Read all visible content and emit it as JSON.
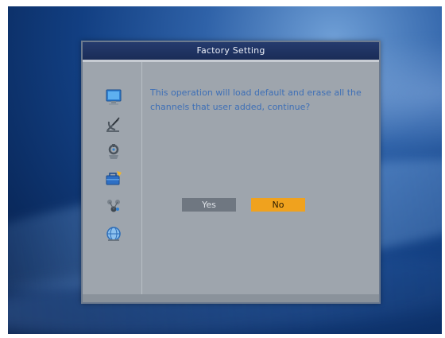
{
  "dialog": {
    "title": "Factory Setting",
    "message": "This operation will load default and erase all the channels that user added, continue?",
    "buttons": {
      "yes_label": "Yes",
      "no_label": "No"
    },
    "selected_button": "No"
  },
  "sidebar": {
    "icons": [
      "monitor-icon",
      "satellite-dish-icon",
      "tools-icon",
      "toolbox-icon",
      "network-icon",
      "globe-icon"
    ],
    "active_icon": "toolbox-icon"
  },
  "colors": {
    "title_bar": "#1f3263",
    "panel": "#9ea5ad",
    "message_text": "#3e6fb6",
    "focused_button": "#f0a21e",
    "unfocused_button": "#6f7781"
  }
}
